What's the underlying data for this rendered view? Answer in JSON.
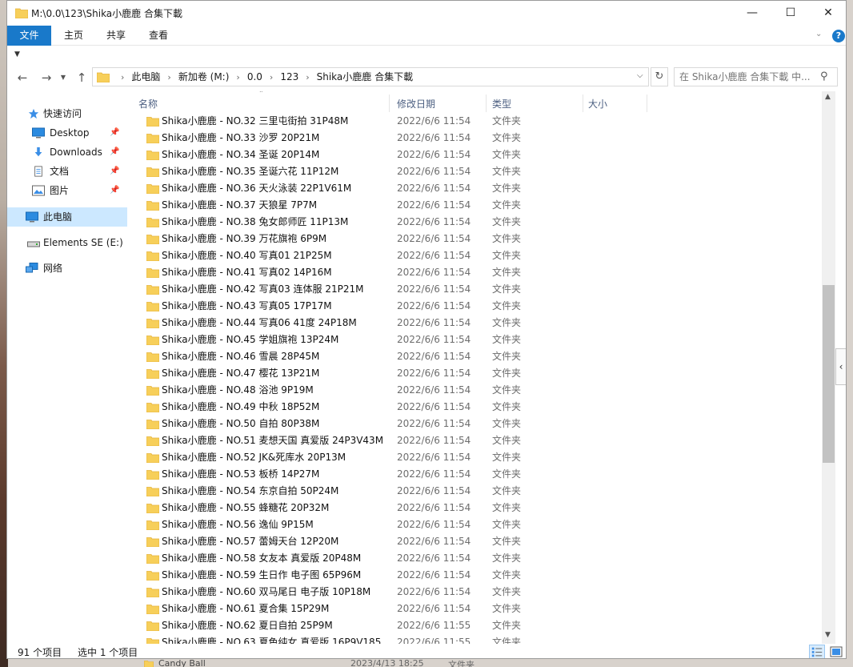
{
  "window": {
    "title": "M:\\0.0\\123\\Shika小鹿鹿 合集下載",
    "controls": {
      "minimize": "—",
      "maximize": "☐",
      "close": "✕"
    }
  },
  "ribbon": {
    "tabs": [
      "文件",
      "主页",
      "共享",
      "查看"
    ],
    "expand_icon": "chevron-down-icon",
    "help_label": "?"
  },
  "address_bar": {
    "breadcrumbs": [
      "此电脑",
      "新加卷 (M:)",
      "0.0",
      "123",
      "Shika小鹿鹿 合集下載"
    ],
    "separator": "›"
  },
  "search": {
    "placeholder": "在 Shika小鹿鹿 合集下載 中..."
  },
  "sidebar": {
    "items": [
      {
        "label": "快速访问",
        "icon": "star-icon"
      },
      {
        "label": "Desktop",
        "icon": "desktop-icon",
        "pinned": true
      },
      {
        "label": "Downloads",
        "icon": "download-icon",
        "pinned": true
      },
      {
        "label": "文档",
        "icon": "document-icon",
        "pinned": true
      },
      {
        "label": "图片",
        "icon": "picture-icon",
        "pinned": true
      },
      {
        "label": "此电脑",
        "icon": "computer-icon",
        "selected": true
      },
      {
        "label": "Elements SE (E:)",
        "icon": "drive-icon"
      },
      {
        "label": "网络",
        "icon": "network-icon"
      }
    ],
    "selected_color": "#cce8ff"
  },
  "file_list": {
    "columns": [
      "名称",
      "修改日期",
      "类型",
      "大小"
    ],
    "rows": [
      {
        "name": "Shika小鹿鹿 - NO.32 三里屯街拍 31P48M",
        "date": "2022/6/6 11:54",
        "type": "文件夹"
      },
      {
        "name": "Shika小鹿鹿 - NO.33 沙罗 20P21M",
        "date": "2022/6/6 11:54",
        "type": "文件夹"
      },
      {
        "name": "Shika小鹿鹿 - NO.34 圣诞 20P14M",
        "date": "2022/6/6 11:54",
        "type": "文件夹"
      },
      {
        "name": "Shika小鹿鹿 - NO.35 圣诞六花 11P12M",
        "date": "2022/6/6 11:54",
        "type": "文件夹"
      },
      {
        "name": "Shika小鹿鹿 - NO.36 天火泳装 22P1V61M",
        "date": "2022/6/6 11:54",
        "type": "文件夹"
      },
      {
        "name": "Shika小鹿鹿 - NO.37 天狼星 7P7M",
        "date": "2022/6/6 11:54",
        "type": "文件夹"
      },
      {
        "name": "Shika小鹿鹿 - NO.38 兔女郎师匠 11P13M",
        "date": "2022/6/6 11:54",
        "type": "文件夹"
      },
      {
        "name": "Shika小鹿鹿 - NO.39 万花旗袍 6P9M",
        "date": "2022/6/6 11:54",
        "type": "文件夹"
      },
      {
        "name": "Shika小鹿鹿 - NO.40 写真01 21P25M",
        "date": "2022/6/6 11:54",
        "type": "文件夹"
      },
      {
        "name": "Shika小鹿鹿 - NO.41 写真02 14P16M",
        "date": "2022/6/6 11:54",
        "type": "文件夹"
      },
      {
        "name": "Shika小鹿鹿 - NO.42 写真03 连体服 21P21M",
        "date": "2022/6/6 11:54",
        "type": "文件夹"
      },
      {
        "name": "Shika小鹿鹿 - NO.43 写真05 17P17M",
        "date": "2022/6/6 11:54",
        "type": "文件夹"
      },
      {
        "name": "Shika小鹿鹿 - NO.44 写真06 41度 24P18M",
        "date": "2022/6/6 11:54",
        "type": "文件夹"
      },
      {
        "name": "Shika小鹿鹿 - NO.45 学姐旗袍 13P24M",
        "date": "2022/6/6 11:54",
        "type": "文件夹"
      },
      {
        "name": "Shika小鹿鹿 - NO.46 雪晨 28P45M",
        "date": "2022/6/6 11:54",
        "type": "文件夹"
      },
      {
        "name": "Shika小鹿鹿 - NO.47 樱花 13P21M",
        "date": "2022/6/6 11:54",
        "type": "文件夹"
      },
      {
        "name": "Shika小鹿鹿 - NO.48 浴池 9P19M",
        "date": "2022/6/6 11:54",
        "type": "文件夹"
      },
      {
        "name": "Shika小鹿鹿 - NO.49 中秋 18P52M",
        "date": "2022/6/6 11:54",
        "type": "文件夹"
      },
      {
        "name": "Shika小鹿鹿 - NO.50 自拍 80P38M",
        "date": "2022/6/6 11:54",
        "type": "文件夹"
      },
      {
        "name": "Shika小鹿鹿 - NO.51 麦想天国 真爱版 24P3V43M",
        "date": "2022/6/6 11:54",
        "type": "文件夹"
      },
      {
        "name": "Shika小鹿鹿 - NO.52 JK&死库水 20P13M",
        "date": "2022/6/6 11:54",
        "type": "文件夹"
      },
      {
        "name": "Shika小鹿鹿 - NO.53 板桥 14P27M",
        "date": "2022/6/6 11:54",
        "type": "文件夹"
      },
      {
        "name": "Shika小鹿鹿 - NO.54 东京自拍 50P24M",
        "date": "2022/6/6 11:54",
        "type": "文件夹"
      },
      {
        "name": "Shika小鹿鹿 - NO.55 蜂糖花 20P32M",
        "date": "2022/6/6 11:54",
        "type": "文件夹"
      },
      {
        "name": "Shika小鹿鹿 - NO.56 逸仙 9P15M",
        "date": "2022/6/6 11:54",
        "type": "文件夹"
      },
      {
        "name": "Shika小鹿鹿 - NO.57 蕾姆天台 12P20M",
        "date": "2022/6/6 11:54",
        "type": "文件夹"
      },
      {
        "name": "Shika小鹿鹿 - NO.58 女友本 真爱版 20P48M",
        "date": "2022/6/6 11:54",
        "type": "文件夹"
      },
      {
        "name": "Shika小鹿鹿 - NO.59 生日作 电子图 65P96M",
        "date": "2022/6/6 11:54",
        "type": "文件夹"
      },
      {
        "name": "Shika小鹿鹿 - NO.60 双马尾日 电子版 10P18M",
        "date": "2022/6/6 11:54",
        "type": "文件夹"
      },
      {
        "name": "Shika小鹿鹿 - NO.61 夏合集 15P29M",
        "date": "2022/6/6 11:54",
        "type": "文件夹"
      },
      {
        "name": "Shika小鹿鹿 - NO.62 夏日自拍 25P9M",
        "date": "2022/6/6 11:55",
        "type": "文件夹"
      },
      {
        "name": "Shika小鹿鹿 - NO.63 夏色纯女 真爱版 16P9V185",
        "date": "2022/6/6 11:55",
        "type": "文件夹"
      }
    ]
  },
  "status_bar": {
    "item_count": "91 个项目",
    "selected": "选中 1 个项目"
  },
  "background_window": {
    "name": "Candy Ball",
    "date": "2023/4/13 18:25",
    "type": "文件夹"
  },
  "colors": {
    "accent": "#1979ca",
    "folder": "#f7cf5a",
    "folder_dark": "#e5b33a",
    "column_header": "#4d6082"
  }
}
